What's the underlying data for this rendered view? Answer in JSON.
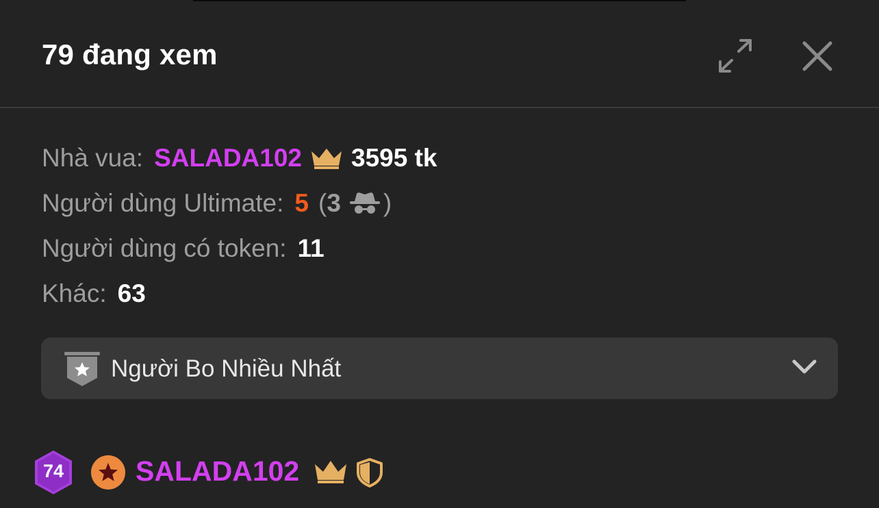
{
  "header": {
    "title": "79 đang xem",
    "expand_icon": "expand-arrows-icon",
    "close_icon": "close-x-icon"
  },
  "stats": {
    "king_label": "Nhà vua:",
    "king_name": "SALADA102",
    "king_tokens": "3595 tk",
    "ultimate_label": "Người dùng Ultimate:",
    "ultimate_count": "5",
    "paren_open": "(",
    "ultimate_hidden": "3",
    "paren_close": ")",
    "token_users_label": "Người dùng có token:",
    "token_users_count": "11",
    "other_label": "Khác:",
    "other_count": "63"
  },
  "dropdown": {
    "label": "Người Bo Nhiều Nhất",
    "icon": "star-shield-icon"
  },
  "user_row": {
    "level": "74",
    "name": "SALADA102",
    "icons": [
      "level-hexagon-icon",
      "star-rank-icon",
      "crown-icon",
      "shield-icon"
    ]
  },
  "colors": {
    "background": "#232323",
    "username": "#d33ff0",
    "crown": "#e5b062",
    "ultimate_count": "#f25b1b",
    "level_badge": "#a43fdc",
    "rank_badge": "#ee8a3f"
  }
}
